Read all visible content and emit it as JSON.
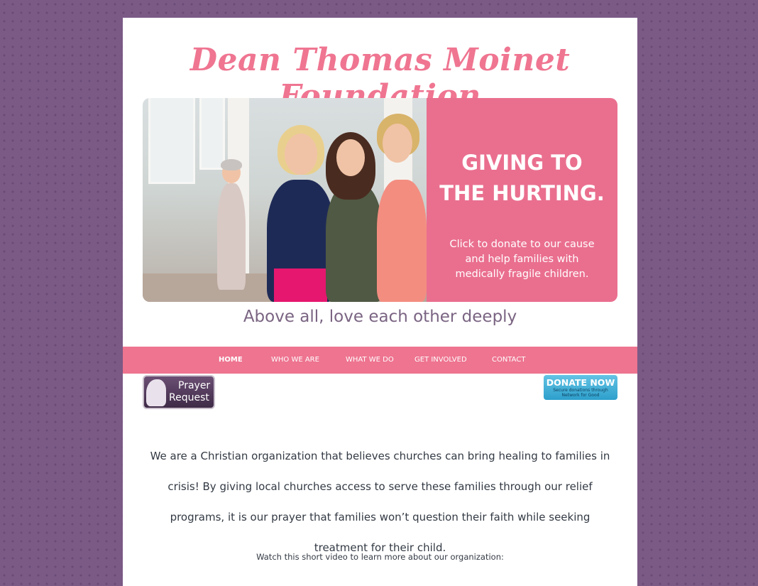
{
  "site": {
    "title": "Dean Thomas Moinet Foundation",
    "tagline": "Above all, love each other deeply"
  },
  "banner": {
    "headline_line1": "GIVING TO",
    "headline_line2": "THE HURTING.",
    "sub_line1": "Click to donate to our cause",
    "sub_line2": "and help families with",
    "sub_line3": "medically fragile children."
  },
  "nav": {
    "items": [
      {
        "label": "Home",
        "active": true
      },
      {
        "label": "Who We Are",
        "active": false
      },
      {
        "label": "What We Do",
        "active": false
      },
      {
        "label": "Get Involved",
        "active": false
      },
      {
        "label": "Contact",
        "active": false
      }
    ]
  },
  "buttons": {
    "prayer_line1": "Prayer",
    "prayer_line2": "Request",
    "donate_line1": "DONATE NOW",
    "donate_line2": "Secure donations through",
    "donate_line3": "Network for Good"
  },
  "content": {
    "intro": "We are a Christian organization that believes churches can bring healing to families in crisis! By giving local churches access to serve these families through our relief programs, it is our prayer that families won’t question their faith while seeking treatment for their child.",
    "video_note": "Watch this short video to learn more about our organization:"
  },
  "colors": {
    "accent_pink": "#ee7490",
    "banner_pink": "#ea6f8f",
    "background_purple": "#7b5a86",
    "tagline_purple": "#7a6482",
    "donate_blue": "#2d9fcc"
  },
  "icons": {
    "prayer": "praying-silhouette-icon"
  }
}
